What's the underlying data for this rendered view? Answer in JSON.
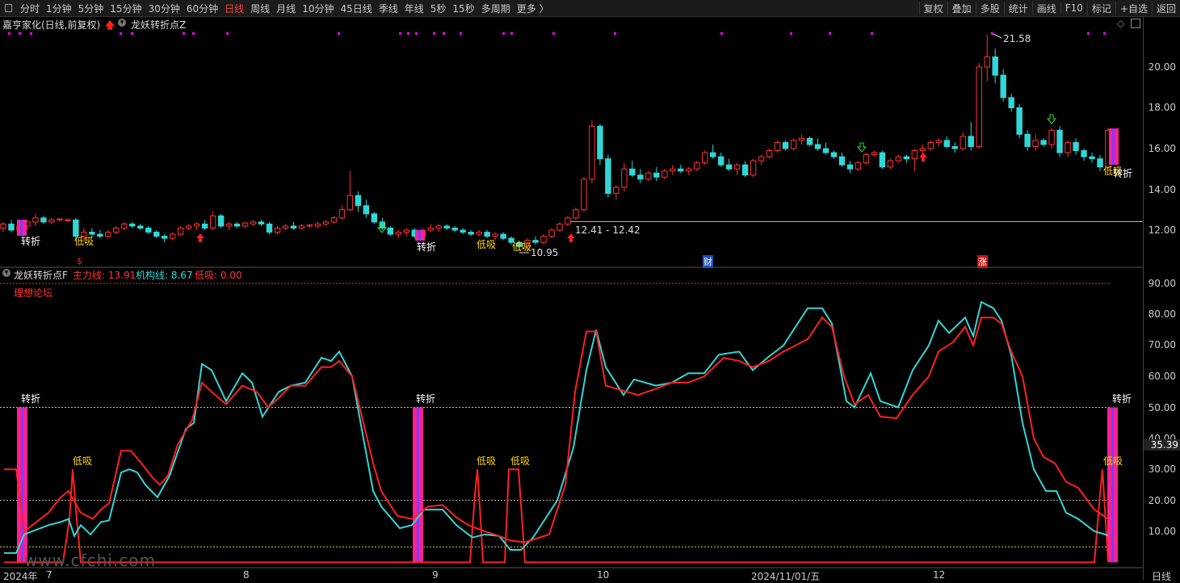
{
  "toolbar": {
    "periods": [
      "分时",
      "1分钟",
      "5分钟",
      "15分钟",
      "30分钟",
      "60分钟",
      "日线",
      "周线",
      "月线",
      "10分钟",
      "45日线",
      "季线",
      "年线",
      "5秒",
      "15秒",
      "多周期",
      "更多 〉"
    ],
    "active_period": "日线",
    "right_buttons": [
      "复权",
      "叠加",
      "多股",
      "统计",
      "画线",
      "F10",
      "标记",
      "+自选",
      "返回"
    ]
  },
  "main_panel": {
    "stock_title": "嘉亨家化(日线,前复权)",
    "indicator_name": "龙妖转折点Z",
    "price_high_label": "21.58",
    "price_low_label": "10.95",
    "range_label": "12.41 - 12.42",
    "turn_label": "转折",
    "dip_label": "低吸",
    "event_cai": "财",
    "event_zhang": "涨",
    "event_s": "$",
    "colors": {
      "up": "#ff3333",
      "down": "#33d6d6",
      "magenta": "#ff00ff",
      "yellow": "#ffd700"
    }
  },
  "sub_panel": {
    "indicator_name": "龙妖转折点F",
    "main_line_label": "主力线: 13.91",
    "inst_line_label": "机构线: 8.67",
    "dip_value_label": "低吸: 0.00",
    "forum_label": "理想论坛",
    "turn_label": "转折",
    "dip_label": "低吸",
    "current_value": "35.39"
  },
  "price_axis": [
    "20.00",
    "18.00",
    "16.00",
    "14.00",
    "12.00"
  ],
  "indicator_axis": [
    "90.00",
    "80.00",
    "70.00",
    "60.00",
    "50.00",
    "40.00",
    "30.00",
    "20.00",
    "10.00"
  ],
  "time_axis": {
    "labels": [
      "2024年",
      "7",
      "8",
      "9",
      "10",
      "2024/11/01/五",
      "12"
    ],
    "period": "日线"
  },
  "watermark": "www.cfchi.com",
  "chart_data": {
    "type": "candlestick",
    "ohlc": [
      [
        12.1,
        12.4,
        11.9,
        12.3
      ],
      [
        12.3,
        12.5,
        11.9,
        12.0
      ],
      [
        12.0,
        12.3,
        11.8,
        12.2
      ],
      [
        12.2,
        12.5,
        12.0,
        12.4
      ],
      [
        12.4,
        12.8,
        12.2,
        12.6
      ],
      [
        12.6,
        12.7,
        12.3,
        12.4
      ],
      [
        12.4,
        12.6,
        12.3,
        12.5
      ],
      [
        12.5,
        12.6,
        12.4,
        12.55
      ],
      [
        12.5,
        12.6,
        12.4,
        12.5
      ],
      [
        12.5,
        12.6,
        11.5,
        11.7
      ],
      [
        11.7,
        12.1,
        11.5,
        11.9
      ],
      [
        11.9,
        12.1,
        11.6,
        11.8
      ],
      [
        11.8,
        12.0,
        11.6,
        11.7
      ],
      [
        11.7,
        12.0,
        11.6,
        11.9
      ],
      [
        11.9,
        12.2,
        11.8,
        12.1
      ],
      [
        12.1,
        12.4,
        12.0,
        12.3
      ],
      [
        12.3,
        12.4,
        12.1,
        12.2
      ],
      [
        12.2,
        12.3,
        12.0,
        12.1
      ],
      [
        12.1,
        12.2,
        11.8,
        11.9
      ],
      [
        11.9,
        12.0,
        11.6,
        11.7
      ],
      [
        11.7,
        11.8,
        11.4,
        11.6
      ],
      [
        11.6,
        11.9,
        11.5,
        11.8
      ],
      [
        11.8,
        12.2,
        11.7,
        12.1
      ],
      [
        12.1,
        12.3,
        12.0,
        12.2
      ],
      [
        12.2,
        12.4,
        12.0,
        12.3
      ],
      [
        12.3,
        12.5,
        12.0,
        12.1
      ],
      [
        12.1,
        12.9,
        12.0,
        12.7
      ],
      [
        12.7,
        12.8,
        12.1,
        12.2
      ],
      [
        12.2,
        12.4,
        12.0,
        12.3
      ],
      [
        12.3,
        12.4,
        12.1,
        12.2
      ],
      [
        12.2,
        12.4,
        12.1,
        12.35
      ],
      [
        12.3,
        12.5,
        12.2,
        12.4
      ],
      [
        12.4,
        12.5,
        12.2,
        12.3
      ],
      [
        12.3,
        12.4,
        11.8,
        11.9
      ],
      [
        11.9,
        12.2,
        11.8,
        12.1
      ],
      [
        12.1,
        12.3,
        12.0,
        12.2
      ],
      [
        12.2,
        12.4,
        12.0,
        12.1
      ],
      [
        12.1,
        12.3,
        12.0,
        12.2
      ],
      [
        12.2,
        12.3,
        12.1,
        12.25
      ],
      [
        12.2,
        12.4,
        12.1,
        12.3
      ],
      [
        12.3,
        12.5,
        12.2,
        12.4
      ],
      [
        12.4,
        12.7,
        12.3,
        12.6
      ],
      [
        12.6,
        13.2,
        12.5,
        13.0
      ],
      [
        13.0,
        14.9,
        12.9,
        13.7
      ],
      [
        13.7,
        13.9,
        12.9,
        13.2
      ],
      [
        13.2,
        13.5,
        12.6,
        12.8
      ],
      [
        12.8,
        12.9,
        12.3,
        12.4
      ],
      [
        12.4,
        12.6,
        12.0,
        12.1
      ],
      [
        12.1,
        12.2,
        11.7,
        11.8
      ],
      [
        11.8,
        12.0,
        11.6,
        11.9
      ],
      [
        11.9,
        12.1,
        11.7,
        12.0
      ],
      [
        12.0,
        12.1,
        11.6,
        11.7
      ],
      [
        11.7,
        12.1,
        11.6,
        12.0
      ],
      [
        12.0,
        12.3,
        11.9,
        12.1
      ],
      [
        12.1,
        12.3,
        11.9,
        12.2
      ],
      [
        12.2,
        12.3,
        12.0,
        12.1
      ],
      [
        12.1,
        12.2,
        11.9,
        12.0
      ],
      [
        12.0,
        12.1,
        11.8,
        11.9
      ],
      [
        11.9,
        12.0,
        11.7,
        11.8
      ],
      [
        11.8,
        12.0,
        11.7,
        11.9
      ],
      [
        11.9,
        12.0,
        11.6,
        11.7
      ],
      [
        11.7,
        11.9,
        11.5,
        11.8
      ],
      [
        11.8,
        11.9,
        11.5,
        11.6
      ],
      [
        11.6,
        11.7,
        11.3,
        11.4
      ],
      [
        11.4,
        11.5,
        11.0,
        11.2
      ],
      [
        11.2,
        11.6,
        10.95,
        11.5
      ],
      [
        11.5,
        11.7,
        11.3,
        11.4
      ],
      [
        11.4,
        11.8,
        11.3,
        11.7
      ],
      [
        11.7,
        12.1,
        11.6,
        12.0
      ],
      [
        12.0,
        12.4,
        11.9,
        12.3
      ],
      [
        12.3,
        12.7,
        12.2,
        12.6
      ],
      [
        12.6,
        13.1,
        12.5,
        13.0
      ],
      [
        13.0,
        14.6,
        12.9,
        14.5
      ],
      [
        14.5,
        17.4,
        14.3,
        17.1
      ],
      [
        17.1,
        17.2,
        15.2,
        15.5
      ],
      [
        15.5,
        15.7,
        13.6,
        13.8
      ],
      [
        13.8,
        14.2,
        13.5,
        14.1
      ],
      [
        14.1,
        15.3,
        13.9,
        15.0
      ],
      [
        15.0,
        15.4,
        14.6,
        14.7
      ],
      [
        14.7,
        15.0,
        14.3,
        14.5
      ],
      [
        14.5,
        14.9,
        14.4,
        14.8
      ],
      [
        14.8,
        15.1,
        14.4,
        14.6
      ],
      [
        14.6,
        15.0,
        14.5,
        14.9
      ],
      [
        14.9,
        15.2,
        14.7,
        15.0
      ],
      [
        15.0,
        15.2,
        14.8,
        14.9
      ],
      [
        14.9,
        15.1,
        14.7,
        15.0
      ],
      [
        15.0,
        15.4,
        14.9,
        15.3
      ],
      [
        15.3,
        15.9,
        15.2,
        15.8
      ],
      [
        15.8,
        16.2,
        15.5,
        15.6
      ],
      [
        15.6,
        15.8,
        15.1,
        15.2
      ],
      [
        15.2,
        15.5,
        14.9,
        15.0
      ],
      [
        15.0,
        15.3,
        14.7,
        15.2
      ],
      [
        15.2,
        15.4,
        14.6,
        14.7
      ],
      [
        14.7,
        15.5,
        14.6,
        15.4
      ],
      [
        15.4,
        15.7,
        15.2,
        15.6
      ],
      [
        15.6,
        16.0,
        15.5,
        15.9
      ],
      [
        15.9,
        16.4,
        15.8,
        16.3
      ],
      [
        16.3,
        16.4,
        15.9,
        16.0
      ],
      [
        16.0,
        16.5,
        15.9,
        16.4
      ],
      [
        16.4,
        16.7,
        16.2,
        16.5
      ],
      [
        16.5,
        16.6,
        16.1,
        16.2
      ],
      [
        16.2,
        16.5,
        15.9,
        16.0
      ],
      [
        16.0,
        16.3,
        15.7,
        15.8
      ],
      [
        15.8,
        15.9,
        15.5,
        15.6
      ],
      [
        15.6,
        15.8,
        15.1,
        15.2
      ],
      [
        15.2,
        15.4,
        14.8,
        15.0
      ],
      [
        15.0,
        15.4,
        14.9,
        15.3
      ],
      [
        15.3,
        15.8,
        15.2,
        15.7
      ],
      [
        15.7,
        15.9,
        15.6,
        15.8
      ],
      [
        15.8,
        15.9,
        15.0,
        15.1
      ],
      [
        15.1,
        15.5,
        15.0,
        15.4
      ],
      [
        15.4,
        15.7,
        15.3,
        15.6
      ],
      [
        15.6,
        15.7,
        15.3,
        15.5
      ],
      [
        15.5,
        16.0,
        14.9,
        15.9
      ],
      [
        15.9,
        16.2,
        15.7,
        16.0
      ],
      [
        16.0,
        16.4,
        15.9,
        16.3
      ],
      [
        16.3,
        16.5,
        16.1,
        16.4
      ],
      [
        16.4,
        16.6,
        16.0,
        16.1
      ],
      [
        16.1,
        16.3,
        15.8,
        16.0
      ],
      [
        16.0,
        16.8,
        15.9,
        16.6
      ],
      [
        16.6,
        17.3,
        15.9,
        16.1
      ],
      [
        16.1,
        20.2,
        16.0,
        20.0
      ],
      [
        20.0,
        21.58,
        19.3,
        20.5
      ],
      [
        20.5,
        20.9,
        19.2,
        19.6
      ],
      [
        19.6,
        19.9,
        18.3,
        18.5
      ],
      [
        18.5,
        18.7,
        17.8,
        18.0
      ],
      [
        18.0,
        18.2,
        16.5,
        16.7
      ],
      [
        16.7,
        16.9,
        15.9,
        16.1
      ],
      [
        16.1,
        16.7,
        15.9,
        16.4
      ],
      [
        16.4,
        16.5,
        16.1,
        16.2
      ],
      [
        16.2,
        17.0,
        16.0,
        16.9
      ],
      [
        16.9,
        17.1,
        15.6,
        15.8
      ],
      [
        15.8,
        16.4,
        15.6,
        16.3
      ],
      [
        16.3,
        16.5,
        15.7,
        15.9
      ],
      [
        15.9,
        16.0,
        15.4,
        15.6
      ],
      [
        15.6,
        15.8,
        15.3,
        15.5
      ],
      [
        15.5,
        15.7,
        14.9,
        15.1
      ],
      [
        15.1,
        17.0,
        15.0,
        16.9
      ]
    ],
    "ylim": [
      11.0,
      22.0
    ],
    "indicator": {
      "main_line_last": 13.91,
      "inst_line_last": 8.67,
      "dip_last": 0.0,
      "ylim": [
        0,
        95
      ]
    }
  }
}
